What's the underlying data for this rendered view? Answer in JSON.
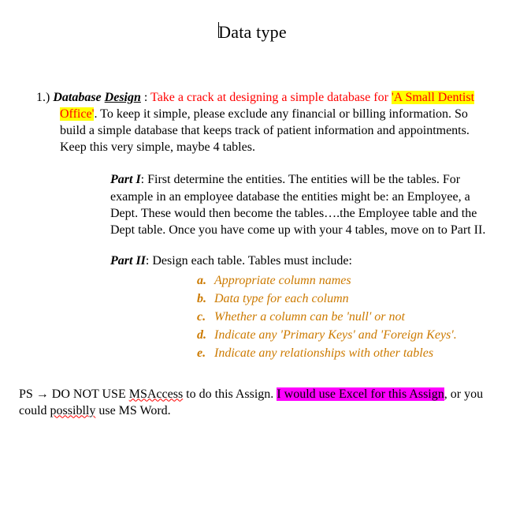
{
  "title": "Data type",
  "q1": {
    "number": "1.)",
    "label_database": "Database",
    "label_design": "Design",
    "colon_space": " : ",
    "red_lead": "Take a crack at designing a simple database for ",
    "highlight_dentist": "'A Small Dentist Office'",
    "period": ".",
    "rest": "  To keep it simple, please exclude any financial or billing information.  So build a simple database that keeps track of patient information and appointments.  Keep this very simple, maybe 4 tables."
  },
  "part1": {
    "heading": "Part I",
    "body": ":  First determine the entities.  The entities will be the tables.  For example in an employee database the entities might be: an Employee, a Dept.  These would then become the tables….the Employee table and the Dept table.   Once you have come up with your 4 tables, move on to Part II."
  },
  "part2": {
    "heading": "Part II",
    "body": ":  Design each table.  Tables must include:",
    "items": [
      {
        "letter": "a.",
        "text": "Appropriate column names"
      },
      {
        "letter": "b.",
        "text": "Data type for each column"
      },
      {
        "letter": "c.",
        "text": "Whether a column can be 'null' or not"
      },
      {
        "letter": "d.",
        "text": "Indicate any 'Primary Keys' and 'Foreign Keys'."
      },
      {
        "letter": "e.",
        "text": "Indicate any relationships with other tables"
      }
    ]
  },
  "ps": {
    "lead": "PS ",
    "arrow": "→",
    "before": "  DO NOT USE ",
    "msaccess": "MSAccess",
    "mid": " to do this Assign.  ",
    "hl1": "I would use Excel for ",
    "hl2": "this Assign",
    "after1": ", or you could ",
    "possiblly": "possiblly",
    "after2": " use MS Word."
  }
}
